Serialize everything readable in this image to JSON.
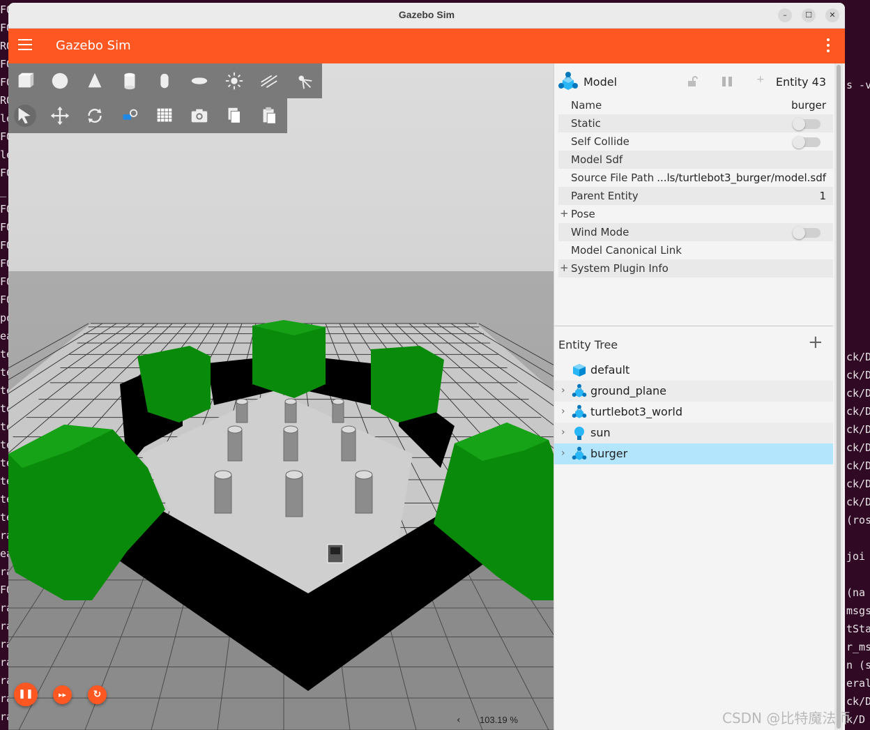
{
  "window": {
    "title": "Gazebo Sim",
    "minimize_glyph": "–",
    "maximize_glyph": "☐",
    "close_glyph": "✕"
  },
  "appbar": {
    "title": "Gazebo Sim"
  },
  "toolbar_shapes": [
    "box-icon",
    "sphere-icon",
    "cone-icon",
    "cylinder-icon",
    "capsule-icon",
    "ellipsoid-icon",
    "sun-light-icon",
    "directional-light-icon",
    "spot-light-icon"
  ],
  "toolbar_transform": [
    "select-icon",
    "translate-icon",
    "rotate-icon",
    "snap-icon",
    "grid-icon",
    "screenshot-icon",
    "copy-icon",
    "paste-icon"
  ],
  "playback": {
    "pause_glyph": "❚❚",
    "step_glyph": "▸▸",
    "reset_glyph": "↻"
  },
  "status": {
    "arrow": "‹",
    "rtf": "103.19 %"
  },
  "component": {
    "title": "Model",
    "entity": "Entity 43",
    "rows": [
      {
        "label": "Name",
        "value": "burger"
      },
      {
        "label": "Static",
        "value": ""
      },
      {
        "label": "Self Collide",
        "value": ""
      },
      {
        "label": "Model Sdf",
        "value": ""
      },
      {
        "label": "Source File Path",
        "value": "...ls/turtlebot3_burger/model.sdf"
      },
      {
        "label": "Parent Entity",
        "value": "1"
      },
      {
        "label": "Pose",
        "value": ""
      },
      {
        "label": "Wind Mode",
        "value": ""
      },
      {
        "label": "Model Canonical Link",
        "value": ""
      },
      {
        "label": "System Plugin Info",
        "value": ""
      }
    ],
    "expand_glyph": "+"
  },
  "entity_tree": {
    "title": "Entity Tree",
    "add_glyph": "+",
    "chevron": "›",
    "items": [
      {
        "label": "default",
        "icon": "world-icon"
      },
      {
        "label": "ground_plane",
        "icon": "model-icon"
      },
      {
        "label": "turtlebot3_world",
        "icon": "model-icon"
      },
      {
        "label": "sun",
        "icon": "light-bulb-icon"
      },
      {
        "label": "burger",
        "icon": "model-icon"
      }
    ]
  },
  "terminal": {
    "left_chars": [
      "FO",
      "FO",
      "RO",
      "FO",
      "FO",
      "RO",
      "le",
      "FO",
      "le",
      "FO",
      "_",
      "FO",
      "FO",
      "FO",
      "FO",
      "FO",
      "FO",
      "po",
      "ea",
      "te",
      "te",
      "te",
      "te",
      "te",
      "te",
      "te",
      "te",
      "te",
      "te",
      "ra",
      "ea",
      "ra",
      "FO",
      "ra",
      "ra",
      "ra",
      "ra",
      "ra",
      "ra",
      "ra",
      "te"
    ],
    "right_lines": [
      "s -v",
      "ck/D",
      "ck/D",
      "ck/D",
      "ck/D",
      "ck/D",
      "ck/D",
      "ck/D",
      "ck/D",
      "ck/D",
      "(ros",
      "joi",
      "(na",
      "msgs",
      "tSta",
      "r_ms",
      "n (s",
      "eral",
      "ck/D",
      "k/D"
    ]
  },
  "watermark": "CSDN @比特魔法师"
}
